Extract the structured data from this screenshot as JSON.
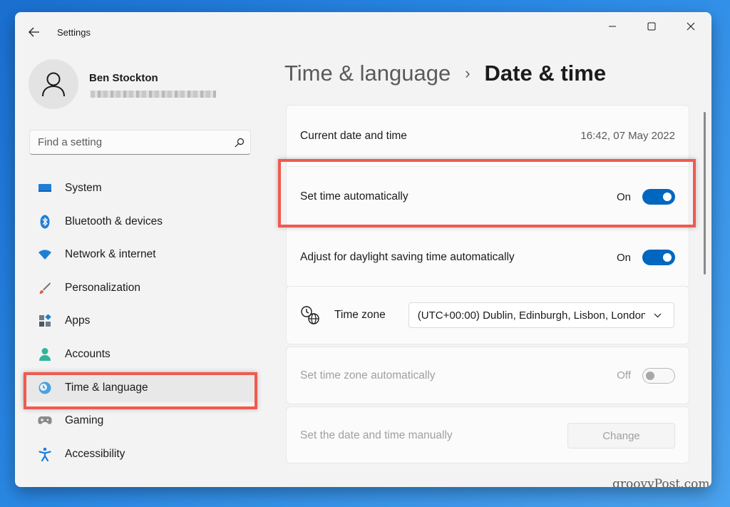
{
  "window": {
    "title": "Settings",
    "controls": [
      "minimize-icon",
      "maximize-icon",
      "close-icon"
    ]
  },
  "profile": {
    "name": "Ben Stockton"
  },
  "search": {
    "placeholder": "Find a setting"
  },
  "nav": {
    "items": [
      {
        "label": "System",
        "icon": "system-icon"
      },
      {
        "label": "Bluetooth & devices",
        "icon": "bluetooth-icon"
      },
      {
        "label": "Network & internet",
        "icon": "wifi-icon"
      },
      {
        "label": "Personalization",
        "icon": "brush-icon"
      },
      {
        "label": "Apps",
        "icon": "apps-icon"
      },
      {
        "label": "Accounts",
        "icon": "account-icon"
      },
      {
        "label": "Time & language",
        "icon": "clock-globe-icon",
        "active": true
      },
      {
        "label": "Gaming",
        "icon": "gamepad-icon"
      },
      {
        "label": "Accessibility",
        "icon": "accessibility-icon"
      }
    ]
  },
  "header": {
    "parent": "Time & language",
    "separator": "›",
    "current": "Date & time"
  },
  "settings": {
    "current_datetime_label": "Current date and time",
    "current_datetime_value": "16:42, 07 May 2022",
    "set_time_auto_label": "Set time automatically",
    "set_time_auto_state": "On",
    "daylight_label": "Adjust for daylight saving time automatically",
    "daylight_state": "On",
    "timezone_label": "Time zone",
    "timezone_value": "(UTC+00:00) Dublin, Edinburgh, Lisbon, London",
    "set_tz_auto_label": "Set time zone automatically",
    "set_tz_auto_state": "Off",
    "manual_label": "Set the date and time manually",
    "change_button": "Change"
  },
  "colors": {
    "accent": "#0067c0",
    "highlight": "#ef5a50"
  },
  "watermark": "groovyPost.com"
}
